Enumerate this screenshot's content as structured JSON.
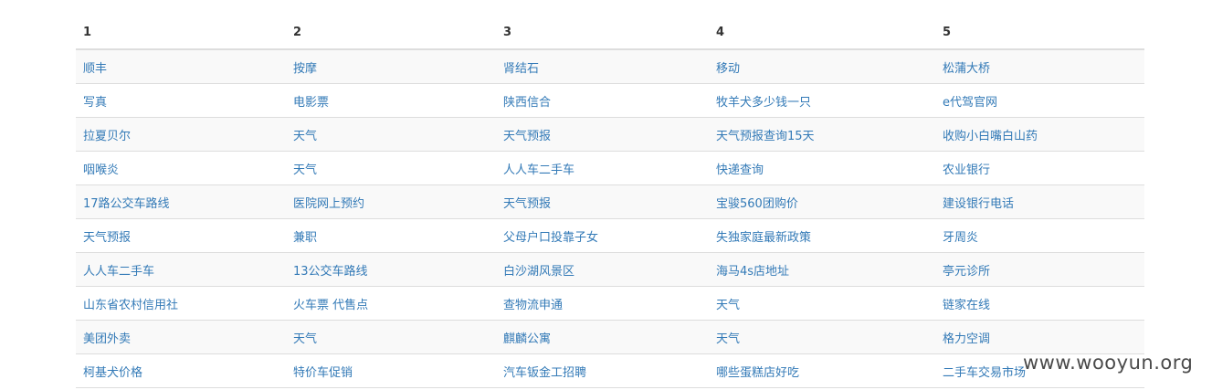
{
  "table": {
    "headers": [
      "1",
      "2",
      "3",
      "4",
      "5"
    ],
    "rows": [
      [
        "顺丰",
        "按摩",
        "肾结石",
        "移动",
        "松蒲大桥"
      ],
      [
        "写真",
        "电影票",
        "陕西信合",
        "牧羊犬多少钱一只",
        "e代驾官网"
      ],
      [
        "拉夏贝尔",
        "天气",
        "天气预报",
        "天气预报查询15天",
        "收购小白嘴白山药"
      ],
      [
        "咽喉炎",
        "天气",
        "人人车二手车",
        "快递查询",
        "农业银行"
      ],
      [
        "17路公交车路线",
        "医院网上预约",
        "天气预报",
        "宝骏560团购价",
        "建设银行电话"
      ],
      [
        "天气预报",
        "兼职",
        "父母户口投靠子女",
        "失独家庭最新政策",
        "牙周炎"
      ],
      [
        "人人车二手车",
        "13公交车路线",
        "白沙湖风景区",
        "海马4s店地址",
        "亭元诊所"
      ],
      [
        "山东省农村信用社",
        "火车票 代售点",
        "查物流申通",
        "天气",
        "链家在线"
      ],
      [
        "美团外卖",
        "天气",
        "麒麟公寓",
        "天气",
        "格力空调"
      ],
      [
        "柯基犬价格",
        "特价车促销",
        "汽车钣金工招聘",
        "哪些蛋糕店好吃",
        "二手车交易市场"
      ]
    ]
  },
  "watermark": {
    "text": "www.wooyun.org"
  },
  "colors": {
    "link": "#337ab7",
    "header_text": "#333333",
    "stripe": "#f9f9f9",
    "border": "#dddddd"
  }
}
